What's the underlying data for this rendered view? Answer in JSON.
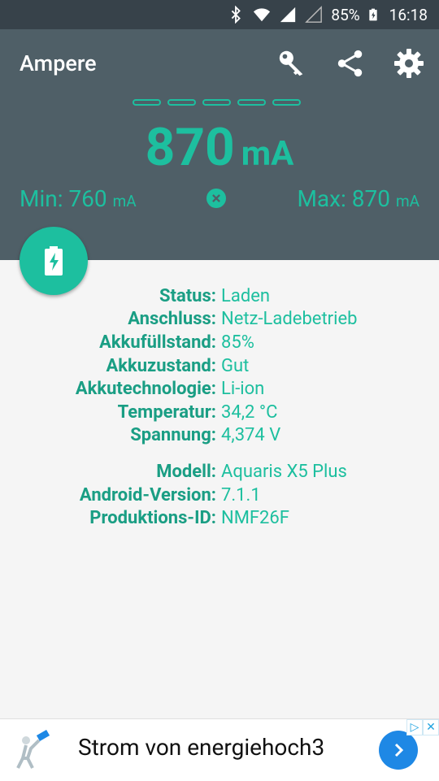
{
  "statusbar": {
    "battery_percent": "85%",
    "time": "16:18"
  },
  "toolbar": {
    "title": "Ampere",
    "icons": [
      "key-icon",
      "share-icon",
      "gear-icon"
    ]
  },
  "meter": {
    "current_value": "870",
    "current_unit": "mA",
    "min_label": "Min: 760",
    "min_unit": "mA",
    "max_label": "Max: 870",
    "max_unit": "mA",
    "accent_color": "#1dbf9f"
  },
  "battery_info": [
    {
      "key": "Status:",
      "value": "Laden"
    },
    {
      "key": "Anschluss:",
      "value": "Netz-Ladebetrieb"
    },
    {
      "key": "Akkufüllstand:",
      "value": "85%"
    },
    {
      "key": "Akkuzustand:",
      "value": "Gut"
    },
    {
      "key": "Akkutechnologie:",
      "value": "Li-ion"
    },
    {
      "key": "Temperatur:",
      "value": "34,2 °C"
    },
    {
      "key": "Spannung:",
      "value": "4,374 V"
    }
  ],
  "device_info": [
    {
      "key": "Modell:",
      "value": "Aquaris X5 Plus"
    },
    {
      "key": "Android-Version:",
      "value": "7.1.1"
    },
    {
      "key": "Produktions-ID:",
      "value": "NMF26F"
    }
  ],
  "ad": {
    "text": "Strom von energiehoch3"
  }
}
